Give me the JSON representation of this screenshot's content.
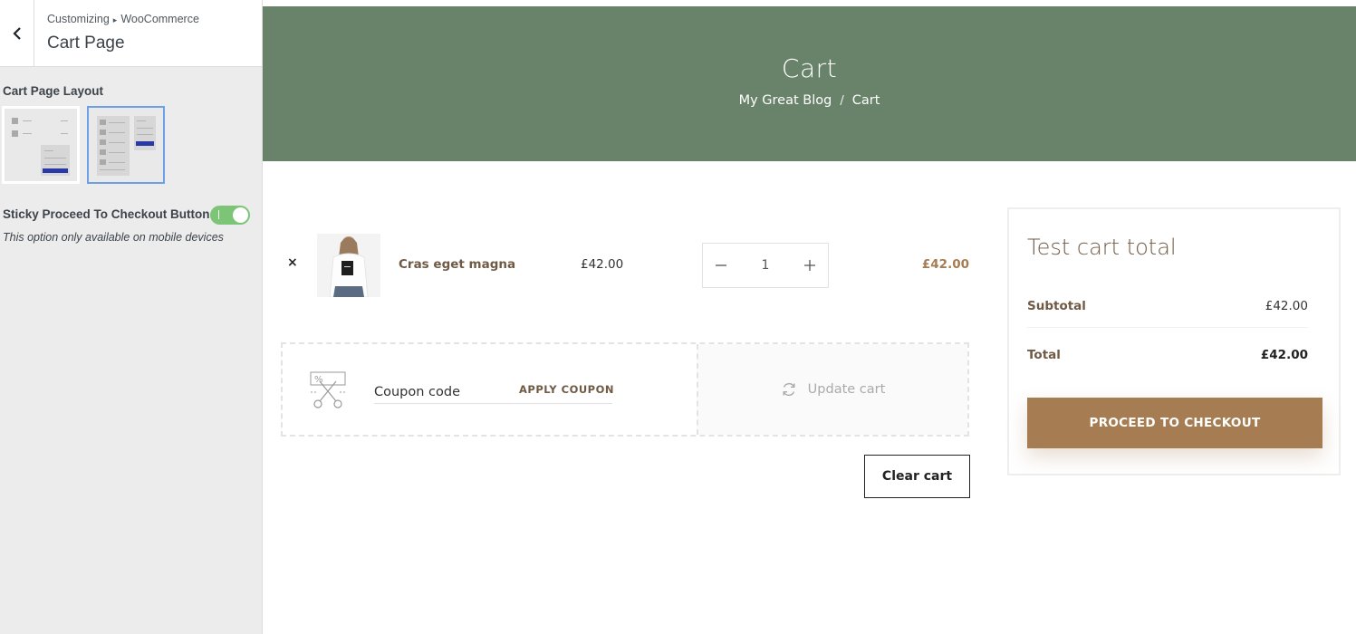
{
  "customizer": {
    "breadcrumb_root": "Customizing",
    "breadcrumb_section": "WooCommerce",
    "title": "Cart Page",
    "layout_label": "Cart Page Layout",
    "layout_selected_index": 1,
    "sticky_label": "Sticky Proceed To Checkout Button",
    "sticky_enabled": true,
    "sticky_note": "This option only available on mobile devices"
  },
  "hero": {
    "title": "Cart",
    "crumb_home": "My Great Blog",
    "crumb_sep": "/",
    "crumb_current": "Cart"
  },
  "cart": {
    "item": {
      "remove_symbol": "×",
      "name": "Cras eget magna",
      "price": "£42.00",
      "quantity": "1",
      "subtotal": "£42.00"
    },
    "coupon": {
      "placeholder": "Coupon code",
      "apply_label": "APPLY COUPON"
    },
    "update_label": "Update cart",
    "clear_label": "Clear cart"
  },
  "totals": {
    "title": "Test cart total",
    "subtotal_label": "Subtotal",
    "subtotal_value": "£42.00",
    "total_label": "Total",
    "total_value": "£42.00",
    "checkout_label": "PROCEED TO CHECKOUT"
  },
  "colors": {
    "hero_bg": "#68836a",
    "accent": "#a67d52",
    "toggle_on": "#7cc576",
    "selected_layout_border": "#6ea0e6"
  }
}
